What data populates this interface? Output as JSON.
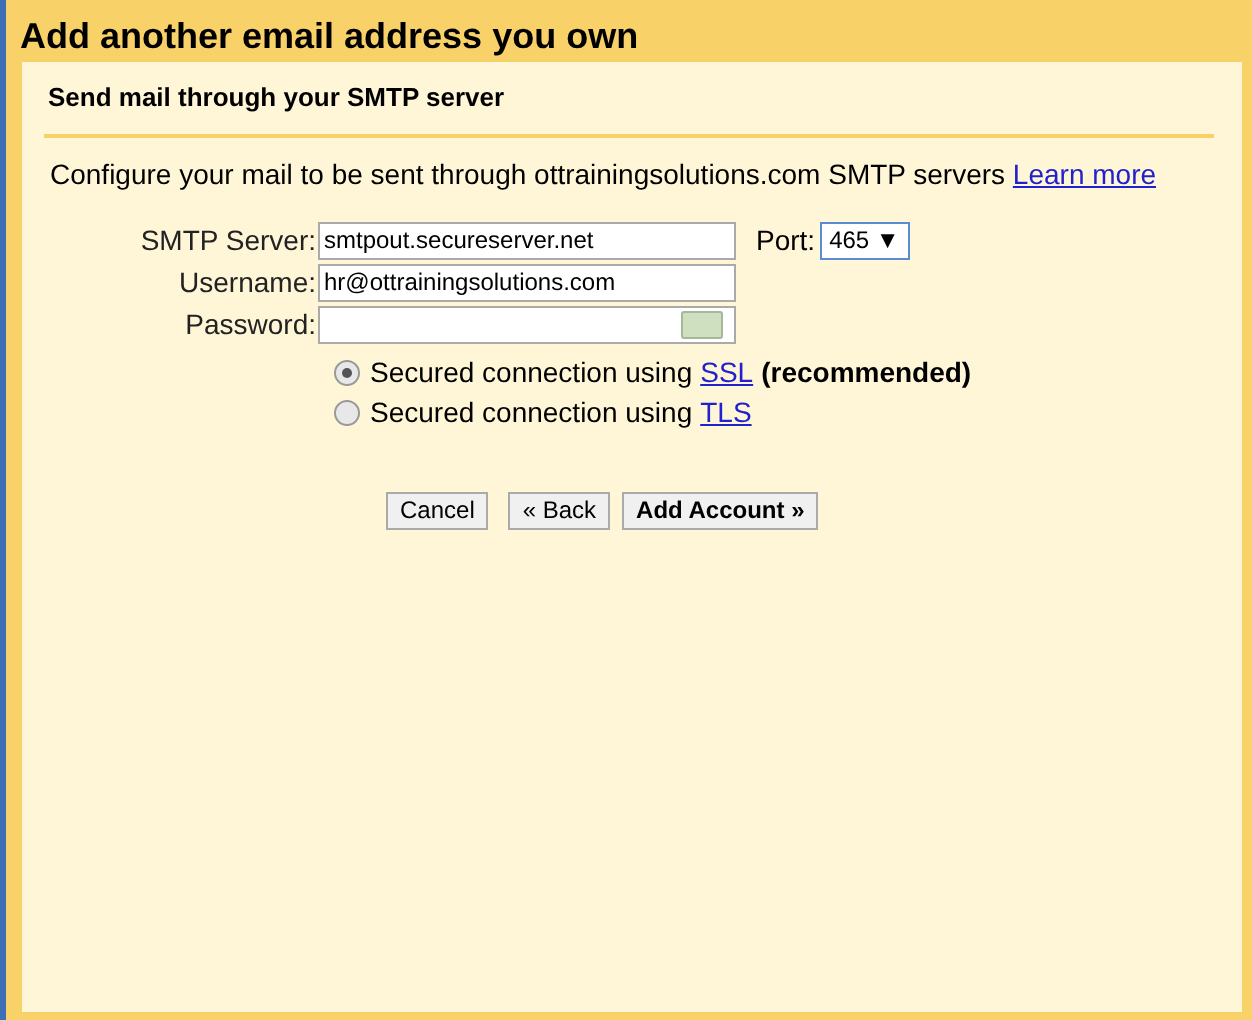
{
  "dialog": {
    "title": "Add another email address you own"
  },
  "section": {
    "heading": "Send mail through your SMTP server"
  },
  "intro": {
    "text": "Configure your mail to be sent through ottrainingsolutions.com SMTP servers",
    "link": "Learn more"
  },
  "fields": [
    {
      "label": "SMTP Server:",
      "value": "smtpout.secureserver.net",
      "kind": "text"
    },
    {
      "label": "Username:",
      "value": "hr@ottrainingsolutions.com",
      "kind": "text"
    },
    {
      "label": "Password:",
      "kind": "password"
    }
  ],
  "port": {
    "label": "Port:",
    "value": "465 ▼"
  },
  "security": [
    {
      "text": "Secured connection using",
      "link": "SSL",
      "note": "(recommended)",
      "selected": true
    },
    {
      "text": "Secured connection using",
      "link": "TLS",
      "selected": false
    }
  ],
  "buttons": [
    {
      "label": "Cancel",
      "primary": false
    },
    {
      "label": "« Back",
      "primary": false
    },
    {
      "label": "Add Account »",
      "primary": true
    }
  ]
}
